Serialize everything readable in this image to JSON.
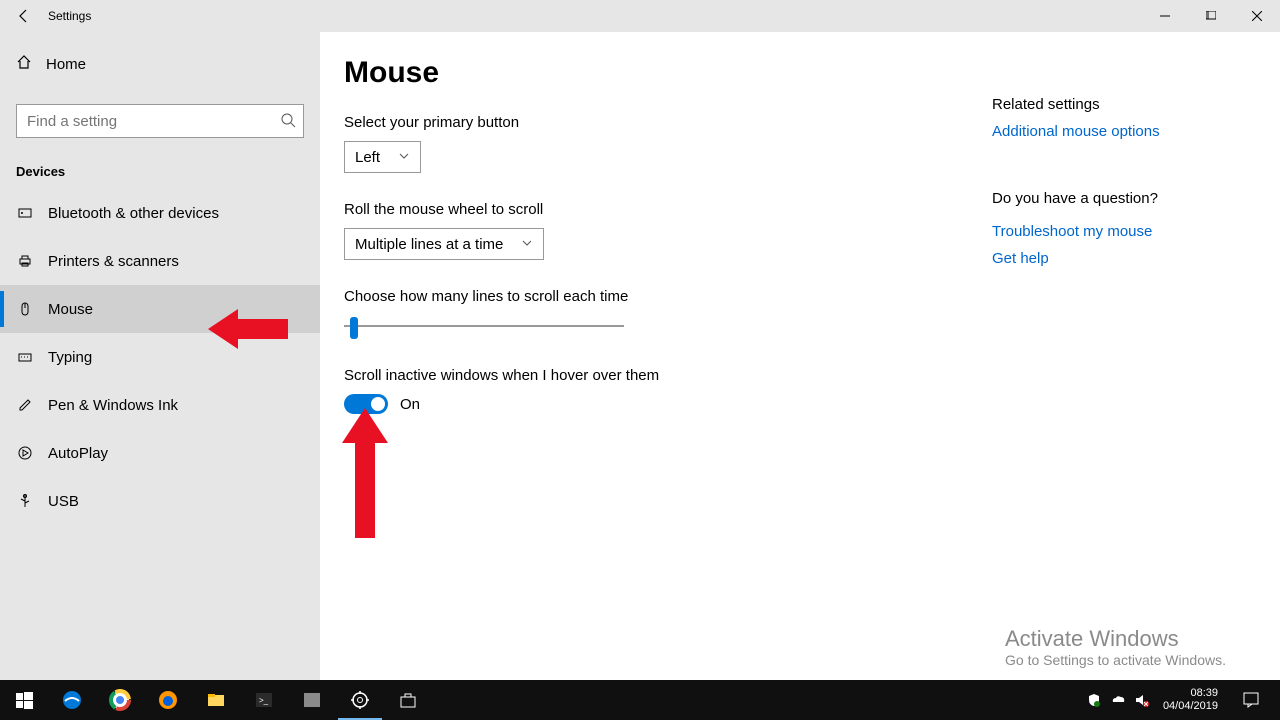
{
  "titlebar": {
    "title": "Settings"
  },
  "sidebar": {
    "home": "Home",
    "search_placeholder": "Find a setting",
    "section": "Devices",
    "items": [
      {
        "label": "Bluetooth & other devices"
      },
      {
        "label": "Printers & scanners"
      },
      {
        "label": "Mouse"
      },
      {
        "label": "Typing"
      },
      {
        "label": "Pen & Windows Ink"
      },
      {
        "label": "AutoPlay"
      },
      {
        "label": "USB"
      }
    ]
  },
  "main": {
    "heading": "Mouse",
    "primary_label": "Select your primary button",
    "primary_value": "Left",
    "roll_label": "Roll the mouse wheel to scroll",
    "roll_value": "Multiple lines at a time",
    "lines_label": "Choose how many lines to scroll each time",
    "inactive_label": "Scroll inactive windows when I hover over them",
    "toggle_state": "On"
  },
  "related": {
    "heading": "Related settings",
    "link1": "Additional mouse options",
    "question": "Do you have a question?",
    "link2": "Troubleshoot my mouse",
    "link3": "Get help"
  },
  "activate": {
    "line1": "Activate Windows",
    "line2": "Go to Settings to activate Windows."
  },
  "taskbar": {
    "time": "08:39",
    "date": "04/04/2019"
  }
}
